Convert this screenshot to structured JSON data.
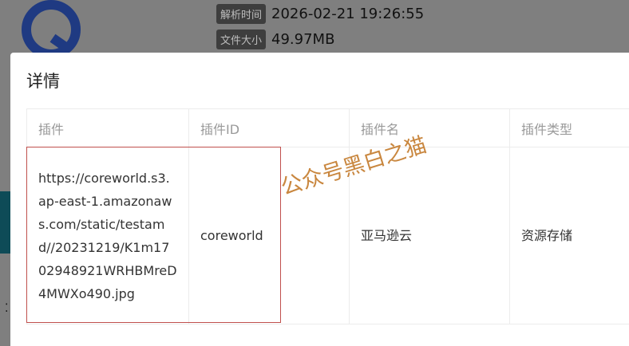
{
  "background": {
    "parse_time_label": "解析时间",
    "parse_time_value": "2026-02-21 19:26:55",
    "file_size_label": "文件大小",
    "file_size_value": "49.97MB"
  },
  "modal": {
    "title": "详情",
    "table": {
      "headers": [
        "插件",
        "插件ID",
        "插件名",
        "插件类型"
      ],
      "rows": [
        {
          "plugin": "https://coreworld.s3.ap-east-1.amazonaws.com/static/testamd//20231219/K1m1702948921WRHBMreD4MWXo490.jpg",
          "plugin_id": "coreworld",
          "plugin_name": "亚马逊云",
          "plugin_type": "资源存储"
        }
      ]
    }
  },
  "watermark": "公众号黑白之猫",
  "colors": {
    "logo": "#1f3a82",
    "highlight_box": "#c0504d",
    "watermark": "#c9873f"
  }
}
